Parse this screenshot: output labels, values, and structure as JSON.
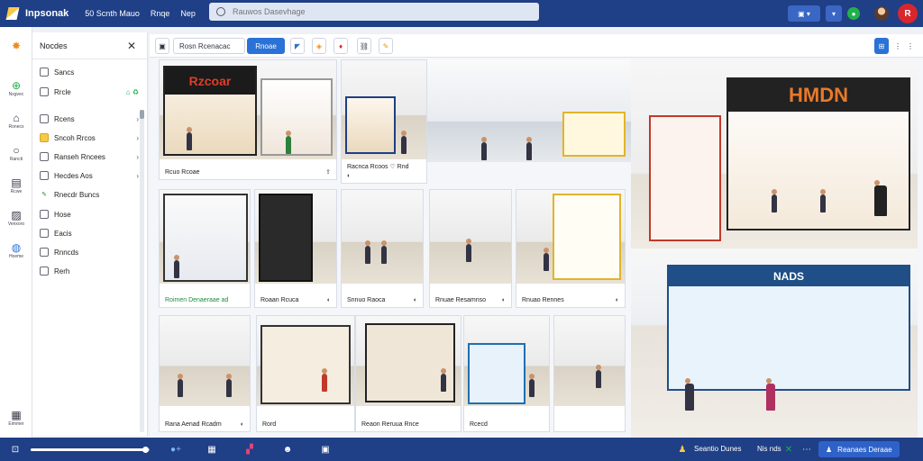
{
  "header": {
    "app_name": "Inpsonak",
    "nav": [
      "50 Scnth Mauo",
      "Rnqe",
      "Nep"
    ],
    "search_placeholder": "Rauwos Dasevhage",
    "right_buttons": [
      "▣ ▾",
      "▣ ▾"
    ],
    "badge": "R"
  },
  "rail": {
    "items": [
      {
        "icon": "plus-circle-icon",
        "label": "Nxgvec"
      },
      {
        "icon": "home-icon",
        "label": "Ronecs"
      },
      {
        "icon": "circle-icon",
        "label": "Rancti"
      },
      {
        "icon": "doc-icon",
        "label": "Rcwe"
      },
      {
        "icon": "image-icon",
        "label": "Venxoro"
      },
      {
        "icon": "globe-icon",
        "label": "Hoeme"
      },
      {
        "icon": "grid-icon",
        "label": "Eimmer"
      }
    ]
  },
  "sidebar": {
    "title": "Nocdes",
    "items": [
      {
        "label": "Sancs",
        "icon": "list-icon",
        "chev": ""
      },
      {
        "label": "Rrcle",
        "icon": "list-icon",
        "chev": "⌂ ♻"
      },
      {
        "label": "Rcens",
        "icon": "list-icon",
        "chev": "›"
      },
      {
        "label": "Sncoh Rrcos",
        "icon": "folder-icon",
        "chev": "›"
      },
      {
        "label": "Ranseh Rncees",
        "icon": "list-icon",
        "chev": "›"
      },
      {
        "label": "Hecdes Aos",
        "icon": "list-icon",
        "chev": "›"
      },
      {
        "label": "Rnecdr Buncs",
        "icon": "pen-icon",
        "chev": ""
      },
      {
        "label": "Hose",
        "icon": "list-icon",
        "chev": ""
      },
      {
        "label": "Eacis",
        "icon": "list-icon",
        "chev": ""
      },
      {
        "label": "Rnncds",
        "icon": "list-icon",
        "chev": ""
      },
      {
        "label": "Rerh",
        "icon": "list-icon",
        "chev": ""
      }
    ]
  },
  "toolbar": {
    "filter_value": "Rosn Rcenacac",
    "primary": "Rnoae",
    "grid_label": "⊞"
  },
  "cards": [
    {
      "caption": "Rcuo Rcoae",
      "green": false
    },
    {
      "caption": "Racnca Rcoos ♡ Rnd",
      "green": false
    },
    {
      "caption": "Roimen Denaeraae ad",
      "green": true
    },
    {
      "caption": "Roaan Rcuca",
      "green": false
    },
    {
      "caption": "Snnuo Raoca",
      "green": false
    },
    {
      "caption": "Rnuae Resamnso",
      "green": false
    },
    {
      "caption": "Rnuao Rennes",
      "green": false
    },
    {
      "caption": "Rana Aenad Rcadm",
      "green": false
    },
    {
      "caption": "Rord",
      "green": false
    },
    {
      "caption": "Reaon Reruua Rnce",
      "green": false
    },
    {
      "caption": "Rcecd",
      "green": false
    }
  ],
  "store_signs": [
    "Rzcoar",
    "HMDN",
    "NADS"
  ],
  "footer": {
    "progress_fraction": 0.96,
    "left_label": "●+",
    "status": "Seantio Dunes",
    "count": "Nis nds",
    "button": "Reanaes Deraae"
  },
  "colors": {
    "brand": "#1f3f86",
    "accent": "#2a72d6",
    "badge": "#d8262d",
    "success": "#21b14b"
  }
}
